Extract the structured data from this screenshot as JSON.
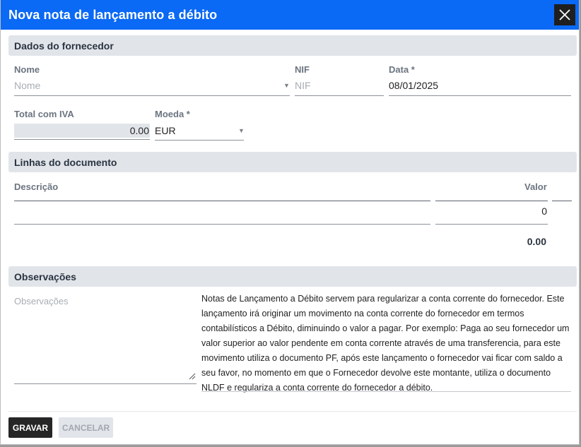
{
  "dialog": {
    "title": "Nova nota de lançamento a débito"
  },
  "supplier": {
    "header": "Dados do fornecedor",
    "name_label": "Nome",
    "name_placeholder": "Nome",
    "nif_label": "NIF",
    "nif_placeholder": "NIF",
    "date_label": "Data *",
    "date_value": "08/01/2025",
    "total_label": "Total com IVA",
    "total_value": "0.00",
    "currency_label": "Moeda *",
    "currency_value": "EUR"
  },
  "lines": {
    "header": "Linhas do documento",
    "description_header": "Descrição",
    "value_header": "Valor",
    "row_value": "0",
    "total": "0.00"
  },
  "observations": {
    "header": "Observações",
    "placeholder": "Observações",
    "info_text": "Notas de Lançamento a Débito servem para regularizar a conta corrente do fornecedor. Este lançamento irá originar um movimento na conta corrente do fornecedor em termos contabilísticos a Débito, diminuindo o valor a pagar. Por exemplo: Paga ao seu fornecedor um valor superior ao valor pendente em conta corrente através de uma transferencia, para este movimento utiliza o documento PF, após este lançamento o fornecedor vai ficar com saldo a seu favor, no momento em que o Fornecedor devolve este montante, utiliza o documento NLDF e regulariza a conta corrente do fornecedor a débito."
  },
  "actions": {
    "save": "GRAVAR",
    "cancel": "CANCELAR"
  },
  "colors": {
    "titlebar": "#0a69f5",
    "section": "#e1e5ea",
    "save_button": "#262626"
  },
  "icons": {
    "close": "close-icon",
    "dropdown": "chevron-down-icon",
    "resize": "resize-handle-icon"
  }
}
